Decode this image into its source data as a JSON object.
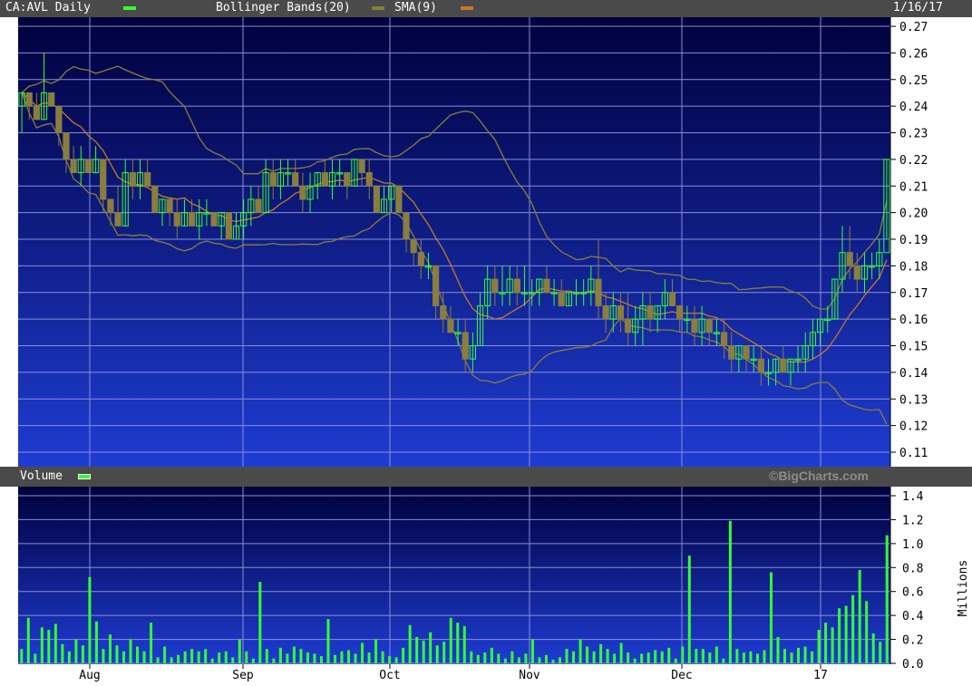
{
  "header": {
    "symbol_label": "CA:AVL Daily",
    "bollinger_label": "Bollinger Bands(20)",
    "sma_label": "SMA(9)",
    "date": "1/16/17"
  },
  "volume_header": {
    "label": "Volume",
    "watermark": "©BigCharts.com"
  },
  "colors": {
    "panel_top": "#00003c",
    "panel_bottom": "#1e3cd2",
    "grid": "#8a8fd8",
    "up": "#33ff33",
    "down": "#8a7e3e",
    "bollinger": "#8a7e3e",
    "sma": "#c8782a",
    "bar": "#4a4a4a"
  },
  "chart_data": [
    {
      "type": "line",
      "title": "CA:AVL Daily",
      "ylim": [
        0.11,
        0.27
      ],
      "yticks": [
        "0.27",
        "0.26",
        "0.25",
        "0.24",
        "0.23",
        "0.22",
        "0.21",
        "0.20",
        "0.19",
        "0.18",
        "0.17",
        "0.16",
        "0.15",
        "0.14",
        "0.13",
        "0.12",
        "0.11"
      ],
      "x_categories": [
        "Aug",
        "Sep",
        "Oct",
        "Nov",
        "Dec",
        "17"
      ],
      "grid": true,
      "legend": "top-left",
      "candles": [
        [
          0.24,
          0.245,
          0.23,
          0.245
        ],
        [
          0.245,
          0.245,
          0.235,
          0.24
        ],
        [
          0.24,
          0.245,
          0.235,
          0.235
        ],
        [
          0.235,
          0.26,
          0.235,
          0.245
        ],
        [
          0.245,
          0.245,
          0.24,
          0.24
        ],
        [
          0.24,
          0.24,
          0.225,
          0.23
        ],
        [
          0.23,
          0.23,
          0.215,
          0.22
        ],
        [
          0.22,
          0.225,
          0.215,
          0.215
        ],
        [
          0.215,
          0.225,
          0.21,
          0.22
        ],
        [
          0.22,
          0.22,
          0.215,
          0.215
        ],
        [
          0.215,
          0.225,
          0.215,
          0.22
        ],
        [
          0.22,
          0.22,
          0.2,
          0.205
        ],
        [
          0.205,
          0.205,
          0.195,
          0.2
        ],
        [
          0.2,
          0.21,
          0.195,
          0.195
        ],
        [
          0.195,
          0.22,
          0.195,
          0.215
        ],
        [
          0.215,
          0.22,
          0.205,
          0.21
        ],
        [
          0.21,
          0.22,
          0.205,
          0.215
        ],
        [
          0.215,
          0.22,
          0.21,
          0.21
        ],
        [
          0.21,
          0.21,
          0.2,
          0.2
        ],
        [
          0.2,
          0.205,
          0.195,
          0.205
        ],
        [
          0.205,
          0.205,
          0.195,
          0.2
        ],
        [
          0.2,
          0.205,
          0.19,
          0.195
        ],
        [
          0.195,
          0.205,
          0.195,
          0.2
        ],
        [
          0.2,
          0.205,
          0.195,
          0.195
        ],
        [
          0.195,
          0.205,
          0.19,
          0.2
        ],
        [
          0.2,
          0.205,
          0.195,
          0.2
        ],
        [
          0.2,
          0.2,
          0.195,
          0.195
        ],
        [
          0.195,
          0.2,
          0.19,
          0.2
        ],
        [
          0.2,
          0.2,
          0.19,
          0.19
        ],
        [
          0.19,
          0.2,
          0.19,
          0.195
        ],
        [
          0.195,
          0.205,
          0.19,
          0.2
        ],
        [
          0.2,
          0.21,
          0.195,
          0.205
        ],
        [
          0.205,
          0.21,
          0.2,
          0.2
        ],
        [
          0.2,
          0.22,
          0.2,
          0.215
        ],
        [
          0.215,
          0.22,
          0.205,
          0.21
        ],
        [
          0.21,
          0.22,
          0.205,
          0.215
        ],
        [
          0.215,
          0.22,
          0.21,
          0.215
        ],
        [
          0.215,
          0.22,
          0.21,
          0.21
        ],
        [
          0.21,
          0.215,
          0.2,
          0.205
        ],
        [
          0.205,
          0.215,
          0.2,
          0.21
        ],
        [
          0.21,
          0.215,
          0.205,
          0.215
        ],
        [
          0.215,
          0.22,
          0.21,
          0.21
        ],
        [
          0.21,
          0.22,
          0.205,
          0.215
        ],
        [
          0.215,
          0.22,
          0.21,
          0.215
        ],
        [
          0.215,
          0.215,
          0.205,
          0.21
        ],
        [
          0.21,
          0.22,
          0.21,
          0.22
        ],
        [
          0.22,
          0.22,
          0.21,
          0.215
        ],
        [
          0.215,
          0.22,
          0.205,
          0.21
        ],
        [
          0.21,
          0.21,
          0.2,
          0.2
        ],
        [
          0.2,
          0.21,
          0.2,
          0.205
        ],
        [
          0.205,
          0.21,
          0.2,
          0.21
        ],
        [
          0.21,
          0.21,
          0.2,
          0.2
        ],
        [
          0.2,
          0.2,
          0.185,
          0.19
        ],
        [
          0.19,
          0.19,
          0.18,
          0.185
        ],
        [
          0.185,
          0.19,
          0.175,
          0.18
        ],
        [
          0.18,
          0.185,
          0.175,
          0.18
        ],
        [
          0.18,
          0.18,
          0.16,
          0.165
        ],
        [
          0.165,
          0.17,
          0.155,
          0.16
        ],
        [
          0.16,
          0.165,
          0.155,
          0.155
        ],
        [
          0.155,
          0.16,
          0.15,
          0.155
        ],
        [
          0.155,
          0.16,
          0.14,
          0.145
        ],
        [
          0.145,
          0.155,
          0.14,
          0.15
        ],
        [
          0.15,
          0.17,
          0.15,
          0.165
        ],
        [
          0.165,
          0.18,
          0.16,
          0.175
        ],
        [
          0.175,
          0.18,
          0.165,
          0.17
        ],
        [
          0.17,
          0.18,
          0.165,
          0.17
        ],
        [
          0.17,
          0.18,
          0.165,
          0.175
        ],
        [
          0.175,
          0.18,
          0.165,
          0.17
        ],
        [
          0.17,
          0.18,
          0.165,
          0.17
        ],
        [
          0.17,
          0.175,
          0.165,
          0.17
        ],
        [
          0.17,
          0.175,
          0.165,
          0.175
        ],
        [
          0.175,
          0.18,
          0.17,
          0.17
        ],
        [
          0.17,
          0.175,
          0.165,
          0.17
        ],
        [
          0.17,
          0.175,
          0.165,
          0.165
        ],
        [
          0.165,
          0.17,
          0.165,
          0.17
        ],
        [
          0.17,
          0.175,
          0.165,
          0.17
        ],
        [
          0.17,
          0.175,
          0.165,
          0.17
        ],
        [
          0.17,
          0.18,
          0.165,
          0.175
        ],
        [
          0.175,
          0.19,
          0.16,
          0.165
        ],
        [
          0.165,
          0.17,
          0.155,
          0.16
        ],
        [
          0.16,
          0.17,
          0.155,
          0.165
        ],
        [
          0.165,
          0.17,
          0.155,
          0.16
        ],
        [
          0.16,
          0.17,
          0.15,
          0.155
        ],
        [
          0.155,
          0.165,
          0.15,
          0.16
        ],
        [
          0.16,
          0.17,
          0.15,
          0.165
        ],
        [
          0.165,
          0.17,
          0.155,
          0.16
        ],
        [
          0.16,
          0.165,
          0.155,
          0.165
        ],
        [
          0.165,
          0.175,
          0.16,
          0.17
        ],
        [
          0.17,
          0.175,
          0.165,
          0.165
        ],
        [
          0.165,
          0.165,
          0.155,
          0.16
        ],
        [
          0.16,
          0.165,
          0.155,
          0.16
        ],
        [
          0.16,
          0.165,
          0.15,
          0.155
        ],
        [
          0.155,
          0.165,
          0.15,
          0.16
        ],
        [
          0.16,
          0.16,
          0.15,
          0.155
        ],
        [
          0.155,
          0.16,
          0.15,
          0.155
        ],
        [
          0.155,
          0.16,
          0.145,
          0.15
        ],
        [
          0.15,
          0.155,
          0.14,
          0.145
        ],
        [
          0.145,
          0.15,
          0.14,
          0.15
        ],
        [
          0.15,
          0.15,
          0.14,
          0.145
        ],
        [
          0.145,
          0.15,
          0.14,
          0.145
        ],
        [
          0.145,
          0.15,
          0.135,
          0.14
        ],
        [
          0.14,
          0.145,
          0.135,
          0.14
        ],
        [
          0.14,
          0.145,
          0.135,
          0.145
        ],
        [
          0.145,
          0.15,
          0.14,
          0.14
        ],
        [
          0.14,
          0.145,
          0.135,
          0.145
        ],
        [
          0.145,
          0.15,
          0.14,
          0.145
        ],
        [
          0.145,
          0.155,
          0.14,
          0.15
        ],
        [
          0.15,
          0.16,
          0.145,
          0.155
        ],
        [
          0.155,
          0.16,
          0.15,
          0.16
        ],
        [
          0.16,
          0.165,
          0.155,
          0.16
        ],
        [
          0.16,
          0.175,
          0.16,
          0.175
        ],
        [
          0.175,
          0.195,
          0.17,
          0.185
        ],
        [
          0.185,
          0.195,
          0.175,
          0.18
        ],
        [
          0.18,
          0.185,
          0.17,
          0.175
        ],
        [
          0.175,
          0.185,
          0.17,
          0.18
        ],
        [
          0.18,
          0.185,
          0.175,
          0.18
        ],
        [
          0.18,
          0.19,
          0.175,
          0.185
        ],
        [
          0.185,
          0.22,
          0.19,
          0.22
        ]
      ]
    },
    {
      "type": "bar",
      "title": "Volume",
      "ylabel": "Millions",
      "ylim": [
        0,
        1.4
      ],
      "yticks": [
        "1.4",
        "1.2",
        "1.0",
        "0.8",
        "0.6",
        "0.4",
        "0.2",
        "0.0"
      ],
      "x_categories": [
        "Aug",
        "Sep",
        "Oct",
        "Nov",
        "Dec",
        "17"
      ],
      "values": [
        0.12,
        0.38,
        0.08,
        0.3,
        0.28,
        0.33,
        0.16,
        0.1,
        0.2,
        0.15,
        0.72,
        0.35,
        0.12,
        0.24,
        0.15,
        0.1,
        0.2,
        0.14,
        0.1,
        0.34,
        0.05,
        0.14,
        0.05,
        0.07,
        0.1,
        0.12,
        0.1,
        0.12,
        0.04,
        0.09,
        0.1,
        0.05,
        0.2,
        0.1,
        0.04,
        0.68,
        0.12,
        0.04,
        0.13,
        0.08,
        0.14,
        0.12,
        0.09,
        0.08,
        0.06,
        0.37,
        0.07,
        0.1,
        0.11,
        0.08,
        0.17,
        0.09,
        0.2,
        0.1,
        0.06,
        0.05,
        0.13,
        0.32,
        0.22,
        0.19,
        0.26,
        0.15,
        0.18,
        0.38,
        0.34,
        0.31,
        0.1,
        0.07,
        0.09,
        0.13,
        0.08,
        0.04,
        0.1,
        0.05,
        0.08,
        0.2,
        0.05,
        0.07,
        0.03,
        0.05,
        0.12,
        0.1,
        0.2,
        0.14,
        0.1,
        0.16,
        0.12,
        0.08,
        0.17,
        0.09,
        0.04,
        0.08,
        0.09,
        0.11,
        0.1,
        0.13,
        0.04,
        0.14,
        0.9,
        0.12,
        0.12,
        0.09,
        0.14,
        0.04,
        1.19,
        0.12,
        0.09,
        0.1,
        0.08,
        0.11,
        0.76,
        0.22,
        0.12,
        0.09,
        0.13,
        0.14,
        0.1,
        0.28,
        0.34,
        0.3,
        0.46,
        0.48,
        0.57,
        0.78,
        0.52,
        0.25,
        0.18,
        1.07
      ]
    }
  ]
}
